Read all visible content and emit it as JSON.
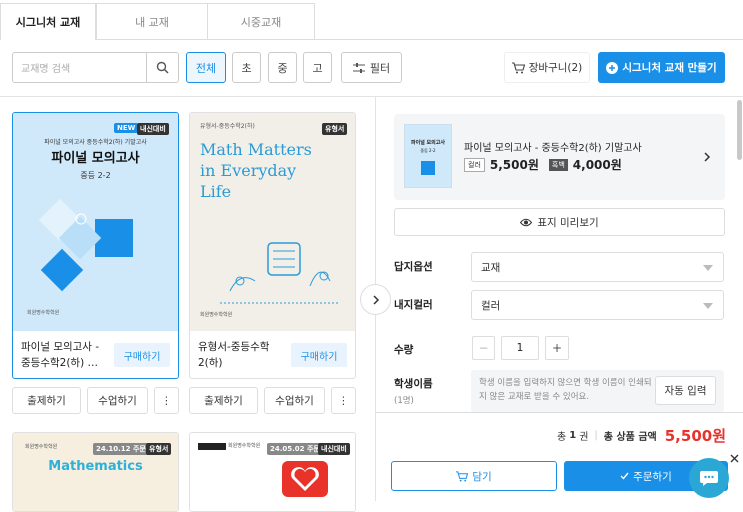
{
  "tabs": [
    {
      "label": "시그니처 교재"
    },
    {
      "label": "내 교재"
    },
    {
      "label": "시중교재"
    }
  ],
  "search": {
    "placeholder": "교재명 검색"
  },
  "filters": {
    "all": "전체",
    "elem": "초",
    "mid": "중",
    "high": "고",
    "filter": "필터"
  },
  "cart_label": "장바구니(2)",
  "make_label": "시그니처 교재 만들기",
  "books": [
    {
      "title": "파이널 모의고사 - 중등수학2(하) …",
      "buy": "구매하기",
      "badge_new": "NEW",
      "badge_type": "내신대비",
      "cover_header": "파이널 모의고사 중등수학2(하) 기말고사",
      "cover_title": "파이널 모의고사",
      "cover_sub": "중등 2-2",
      "publisher": "회원명수학학원"
    },
    {
      "title": "유형서-중등수학2(하)",
      "buy": "구매하기",
      "badge_type": "유형서",
      "cover_header": "유형서-중등수학2(하)",
      "cover_title_lines": [
        "Math Matters",
        "in Everyday",
        "Life"
      ],
      "publisher": "회원명수학학원"
    },
    {
      "badge_date": "24.10.12 주문",
      "badge_type": "유형서",
      "cover_title": "Mathematics",
      "publisher": "회원명수학학원"
    },
    {
      "badge_date": "24.05.02 주문",
      "badge_type": "내신대비",
      "publisher": "회원명수학학원"
    }
  ],
  "card_actions": {
    "exam": "출제하기",
    "class": "수업하기",
    "more": "⋮"
  },
  "product": {
    "name": "파이널 모의고사 - 중등수학2(하) 기말고사",
    "color_tag": "컬러",
    "color_price": "5,500원",
    "bw_tag": "흑백",
    "bw_price": "4,000원",
    "thumb_title": "파이널 모의고사",
    "thumb_sub": "중등 2-2"
  },
  "preview_label": "표지 미리보기",
  "options": {
    "answer_label": "답지옵션",
    "answer_value": "교재",
    "color_label": "내지컬러",
    "color_value": "컬러",
    "qty_label": "수량",
    "qty_value": "1",
    "student_label": "학생이름",
    "student_sub": "(1명)",
    "student_hint": "학생 이름을 입력하지 않으면 학생 이름이 인쇄되지 않은 교재로 받을 수 있어요.",
    "auto_label": "자동 입력"
  },
  "summary": {
    "prefix": "총",
    "count": "1",
    "unit": "권",
    "total_label": "총 상품 금액",
    "total": "5,500원"
  },
  "actions": {
    "add": "담기",
    "order": "주문하기"
  },
  "colors": {
    "accent": "#1a8fe8",
    "price": "#e8322a"
  }
}
